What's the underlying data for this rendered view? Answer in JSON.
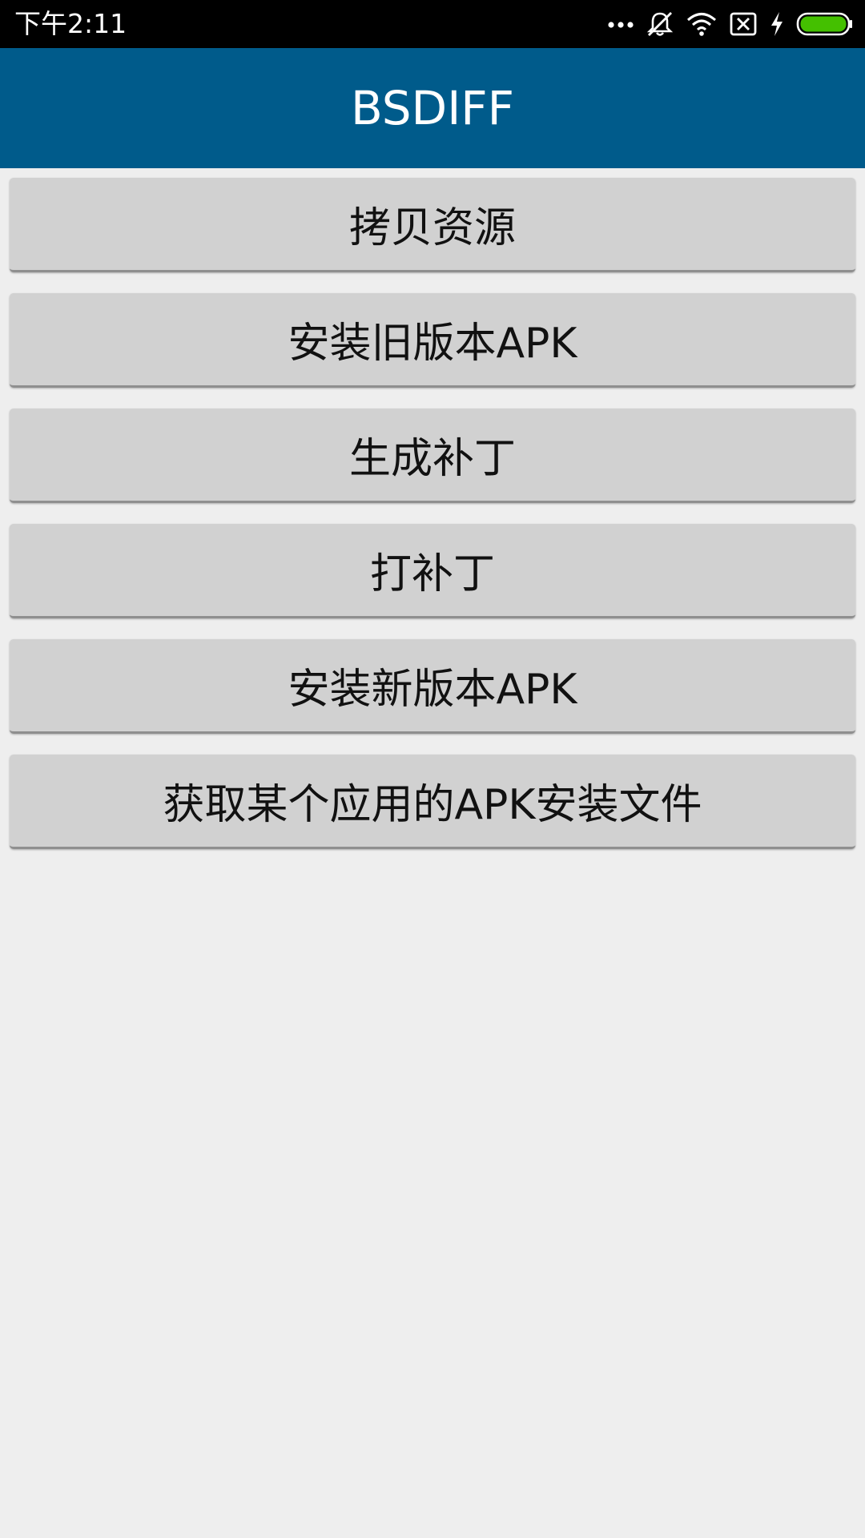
{
  "status_bar": {
    "time": "下午2:11",
    "icons": [
      "more-dots-icon",
      "silent-bell-icon",
      "wifi-icon",
      "no-sim-icon",
      "charging-bolt-icon",
      "battery-icon"
    ],
    "battery_color": "#44c000"
  },
  "app_bar": {
    "title": "BSDIFF",
    "background": "#005b8b"
  },
  "buttons": [
    {
      "label": "拷贝资源"
    },
    {
      "label": "安装旧版本APK"
    },
    {
      "label": "生成补丁"
    },
    {
      "label": "打补丁"
    },
    {
      "label": "安装新版本APK"
    },
    {
      "label": "获取某个应用的APK安装文件"
    }
  ]
}
